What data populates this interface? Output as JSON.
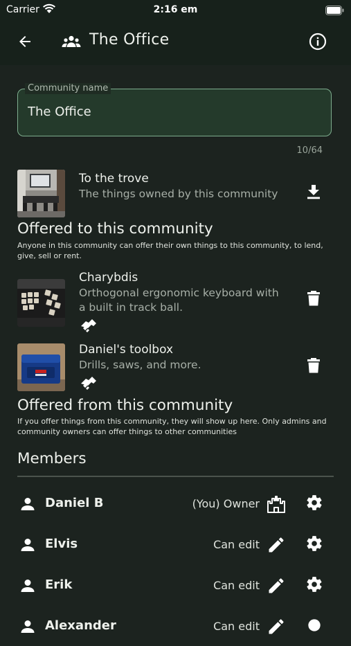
{
  "status_bar": {
    "carrier": "Carrier",
    "time": "2:16 em"
  },
  "app_bar": {
    "title": "The Office",
    "back_icon": "arrow-left-icon",
    "group_icon": "group-icon",
    "info_icon": "info-icon"
  },
  "community_field": {
    "label": "Community name",
    "value": "The Office",
    "counter": "10/64"
  },
  "trove": {
    "title": "To the trove",
    "subtitle": "The things owned by this community",
    "action_icon": "download-icon"
  },
  "offered_to": {
    "title": "Offered to this community",
    "description": "Anyone in this community can offer their own things to this community, to lend, give, sell or rent.",
    "items": [
      {
        "title": "Charybdis",
        "subtitle": "Orthogonal ergonomic keyboard with a built in track ball.",
        "badge_icon": "handshake-icon",
        "action_icon": "delete-icon"
      },
      {
        "title": "Daniel's toolbox",
        "subtitle": "Drills, saws, and more.",
        "badge_icon": "handshake-icon",
        "action_icon": "delete-icon"
      }
    ]
  },
  "offered_from": {
    "title": "Offered from this community",
    "description": "If you offer things from this community, they will show up here. Only admins and community owners can offer things to other communities"
  },
  "members": {
    "title": "Members",
    "list": [
      {
        "name": "Daniel B",
        "role": "(You)  Owner",
        "role_icon": "castle-icon"
      },
      {
        "name": "Elvis",
        "role": "Can edit",
        "role_icon": "pencil-icon"
      },
      {
        "name": "Erik",
        "role": "Can edit",
        "role_icon": "pencil-icon"
      },
      {
        "name": "Alexander",
        "role": "Can edit",
        "role_icon": "pencil-icon"
      }
    ]
  },
  "colors": {
    "background": "#1c231f",
    "app_bar": "#17211b",
    "field_fill": "#243a2b",
    "field_border": "#7fae8f"
  }
}
